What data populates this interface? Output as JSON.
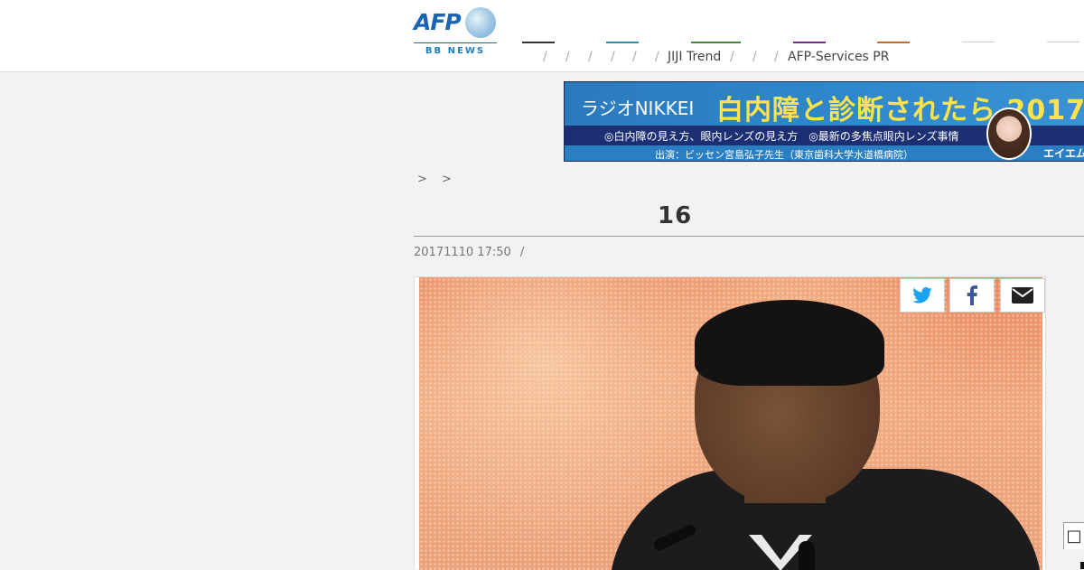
{
  "header": {
    "logo": {
      "name": "AFP",
      "sub": "BB NEWS",
      "colors": {
        "primary": "#1a64b4",
        "sub": "#1a7fc4"
      }
    },
    "nav": {
      "items": [
        {
          "label": "",
          "color": "#333333"
        },
        {
          "label": "",
          "color": "#2a8fa8"
        },
        {
          "label": "",
          "color": "#3a8a3a"
        },
        {
          "label": "",
          "color": "#7a2a8a"
        },
        {
          "label": "",
          "color": "#d2691e"
        },
        {
          "label": "",
          "color": "#cccccc"
        },
        {
          "label": "",
          "color": "#cccccc"
        }
      ],
      "links": [
        {
          "label": "JIJI Trend"
        },
        {
          "label": "AFP-Services PR"
        }
      ],
      "separator": "/"
    }
  },
  "banner": {
    "brand": "ラジオNIKKEI",
    "headline": "白内障と診断されたら 2017",
    "line1": "◎白内障の見え方、眼内レンズの見え方　◎最新の多焦点眼内レンズ事情",
    "line2": "出演：ビッセン宮島弘子先生（東京歯科大学水道橋病院）",
    "corner": "エイエム",
    "colors": {
      "top": "#2b79bd",
      "middle": "#1c2f72",
      "headline": "#ffe34a"
    }
  },
  "breadcrumb": {
    "separators": "> >"
  },
  "article": {
    "title": "　　　　　　　　　　16　　　　　　　　　　　",
    "date": "20171110 17:50",
    "separator": "/"
  },
  "share": {
    "icons": [
      "twitter-icon",
      "facebook-icon",
      "email-icon"
    ],
    "colors": {
      "twitter": "#1da1f2",
      "facebook": "#3b5998",
      "email": "#222222"
    }
  },
  "side_widget": {
    "text": "□"
  }
}
